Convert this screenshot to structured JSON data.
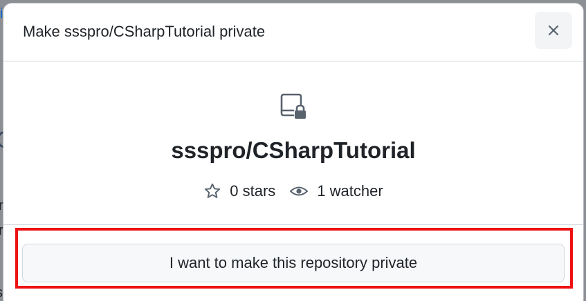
{
  "dialog": {
    "title": "Make ssspro/CSharpTutorial private",
    "close_icon": "close-icon"
  },
  "repo": {
    "icon": "repo-locked-icon",
    "name": "ssspro/CSharpTutorial",
    "stars_label": "0 stars",
    "stars_icon": "star-icon",
    "watchers_label": "1 watcher",
    "watchers_icon": "eye-icon"
  },
  "confirm_button": {
    "label": "I want to make this repository private"
  },
  "highlight": {
    "color": "#ee1111"
  },
  "background_fragments": [
    "i",
    "C",
    "n",
    "r",
    "s."
  ]
}
